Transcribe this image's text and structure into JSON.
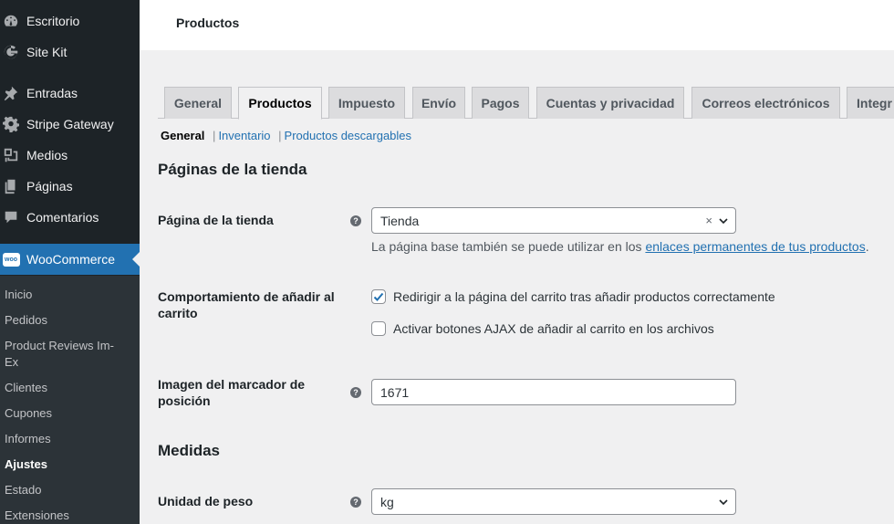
{
  "sidebar": {
    "items": [
      {
        "label": "Escritorio",
        "icon": "dashboard-icon"
      },
      {
        "label": "Site Kit",
        "icon": "google-g-icon"
      },
      {
        "label": "Entradas",
        "icon": "pushpin-icon"
      },
      {
        "label": "Stripe Gateway",
        "icon": "gear-icon"
      },
      {
        "label": "Medios",
        "icon": "media-icon"
      },
      {
        "label": "Páginas",
        "icon": "pages-icon"
      },
      {
        "label": "Comentarios",
        "icon": "comment-icon"
      },
      {
        "label": "WooCommerce",
        "icon": "woocommerce-icon",
        "badge": "woo"
      }
    ],
    "submenu": [
      "Inicio",
      "Pedidos",
      "Product Reviews Im-Ex",
      "Clientes",
      "Cupones",
      "Informes",
      "Ajustes",
      "Estado",
      "Extensiones"
    ],
    "current_submenu": "Ajustes"
  },
  "header": {
    "title": "Productos"
  },
  "tabs": [
    "General",
    "Productos",
    "Impuesto",
    "Envío",
    "Pagos",
    "Cuentas y privacidad",
    "Correos electrónicos",
    "Integr"
  ],
  "active_tab": "Productos",
  "subnav": {
    "current": "General",
    "links": [
      "Inventario",
      "Productos descargables"
    ],
    "separator": "|"
  },
  "sections": {
    "store_pages": "Páginas de la tienda",
    "measures": "Medidas"
  },
  "fields": {
    "shop_page": {
      "label": "Página de la tienda",
      "value": "Tienda",
      "clear": "×",
      "desc_prefix": "La página base también se puede utilizar en los ",
      "desc_link": "enlaces permanentes de tus productos",
      "desc_suffix": "."
    },
    "add_to_cart": {
      "label": "Comportamiento de añadir al carrito",
      "options": [
        {
          "label": "Redirigir a la página del carrito tras añadir productos correctamente",
          "checked": true
        },
        {
          "label": "Activar botones AJAX de añadir al carrito en los archivos",
          "checked": false
        }
      ]
    },
    "placeholder_image": {
      "label": "Imagen del marcador de posición",
      "value": "1671"
    },
    "weight_unit": {
      "label": "Unidad de peso",
      "value": "kg"
    }
  },
  "help_glyph": "?",
  "colors": {
    "sidebar_bg": "#1d2327",
    "submenu_bg": "#2c3338",
    "accent": "#2271b1",
    "page_bg": "#f0f0f1"
  }
}
